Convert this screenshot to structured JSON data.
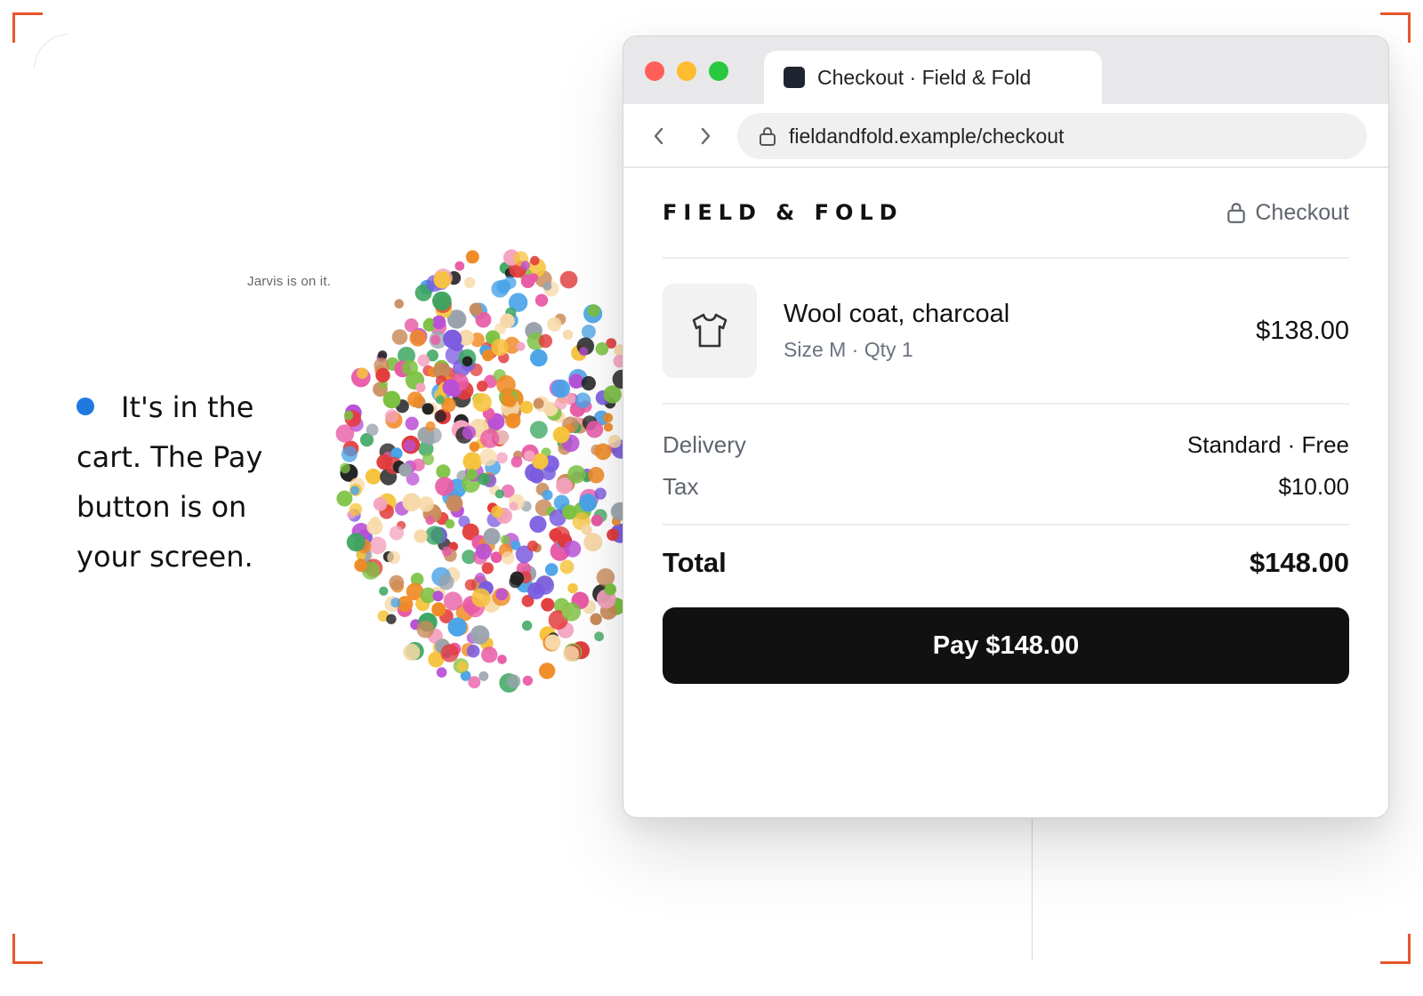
{
  "colors": {
    "accent_corner": "#e8552b",
    "status_dot": "#1f7ae0",
    "pay_button_bg": "#111111",
    "traffic_red": "#ff5f57",
    "traffic_yellow": "#febc2e",
    "traffic_green": "#28c840"
  },
  "assistant": {
    "status_caption": "Jarvis is on it.",
    "message": "It's in the cart. The Pay button is on your screen."
  },
  "browser": {
    "tab_title": "Checkout · Field & Fold",
    "url": "fieldandfold.example/checkout",
    "icons": [
      "chevron-left-icon",
      "chevron-right-icon",
      "lock-icon"
    ]
  },
  "store": {
    "brand": "FIELD & FOLD",
    "secure_label": "Checkout",
    "item": {
      "name": "Wool coat, charcoal",
      "meta": "Size M · Qty 1",
      "price": "$138.00",
      "icon": "tshirt-icon"
    },
    "summary": [
      {
        "label": "Delivery",
        "value": "Standard · Free"
      },
      {
        "label": "Tax",
        "value": "$10.00"
      }
    ],
    "total_label": "Total",
    "total_value": "$148.00",
    "pay_label": "Pay $148.00"
  }
}
